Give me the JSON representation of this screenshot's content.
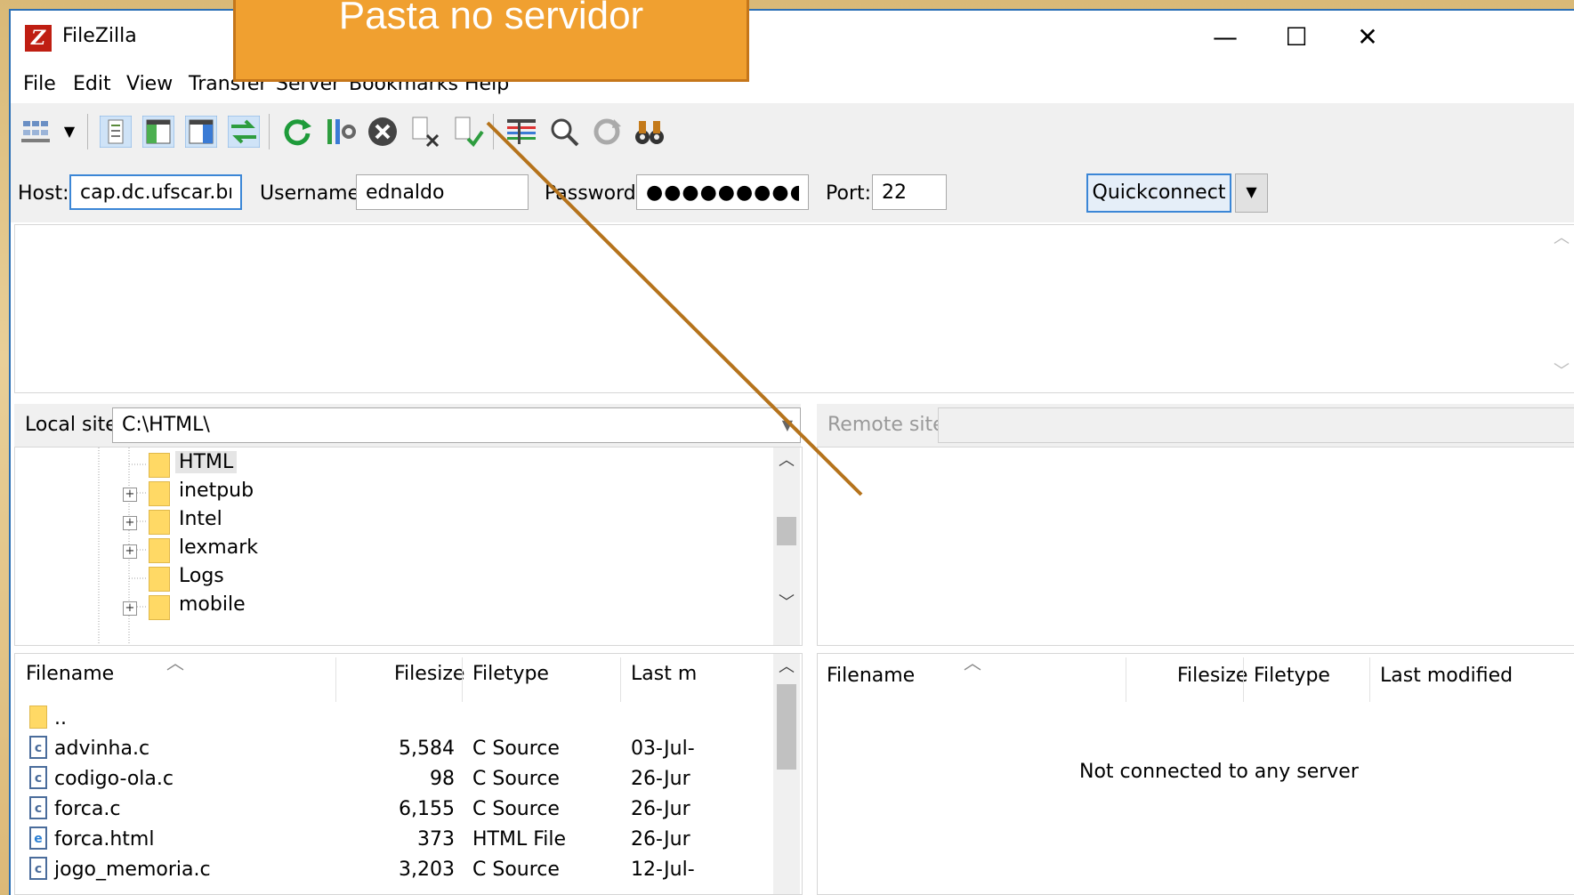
{
  "window": {
    "title": "FileZilla",
    "minimize": "—",
    "maximize": "☐",
    "close": "✕"
  },
  "menu": [
    "File",
    "Edit",
    "View",
    "Transfer",
    "Server",
    "Bookmarks",
    "Help"
  ],
  "toolbar": {
    "icons": [
      "site-manager-icon",
      "dropdown-icon",
      "toggle-log-icon",
      "toggle-local-tree-icon",
      "toggle-remote-tree-icon",
      "toggle-queue-icon",
      "refresh-icon",
      "process-queue-icon",
      "cancel-icon",
      "disconnect-icon",
      "reconnect-icon",
      "filter-icon",
      "compare-icon",
      "sync-browse-icon",
      "search-binoculars-icon"
    ]
  },
  "quickconnect": {
    "host_label": "Host:",
    "host_value": "cap.dc.ufscar.br",
    "username_label": "Username:",
    "username_value": "ednaldo",
    "password_label": "Password:",
    "password_value": "●●●●●●●●●●●",
    "port_label": "Port:",
    "port_value": "22",
    "button": "Quickconnect",
    "dropdown": "▼"
  },
  "local_site": {
    "label": "Local site:",
    "path": "C:\\HTML\\",
    "tree": [
      {
        "name": "HTML",
        "expandable": false,
        "selected": true
      },
      {
        "name": "inetpub",
        "expandable": true
      },
      {
        "name": "Intel",
        "expandable": true
      },
      {
        "name": "lexmark",
        "expandable": true
      },
      {
        "name": "Logs",
        "expandable": false
      },
      {
        "name": "mobile",
        "expandable": true
      }
    ]
  },
  "remote_site": {
    "label": "Remote site:",
    "path": ""
  },
  "local_files": {
    "columns": [
      "Filename",
      "Filesize",
      "Filetype",
      "Last m"
    ],
    "rows": [
      {
        "icon": "dir",
        "name": "..",
        "size": "",
        "type": "",
        "modified": ""
      },
      {
        "icon": "c",
        "name": "advinha.c",
        "size": "5,584",
        "type": "C Source",
        "modified": "03-Jul-"
      },
      {
        "icon": "c",
        "name": "codigo-ola.c",
        "size": "98",
        "type": "C Source",
        "modified": "26-Jur"
      },
      {
        "icon": "c",
        "name": "forca.c",
        "size": "6,155",
        "type": "C Source",
        "modified": "26-Jur"
      },
      {
        "icon": "html",
        "name": "forca.html",
        "size": "373",
        "type": "HTML File",
        "modified": "26-Jur"
      },
      {
        "icon": "c",
        "name": "jogo_memoria.c",
        "size": "3,203",
        "type": "C Source",
        "modified": "12-Jul-"
      }
    ]
  },
  "remote_files": {
    "columns": [
      "Filename",
      "Filesize",
      "Filetype",
      "Last modified"
    ],
    "message": "Not connected to any server"
  },
  "annotation": {
    "callout": "Pasta no servidor"
  },
  "colors": {
    "callout_fill": "#f0a030",
    "pointer_line": "#b5731c",
    "focus_blue": "#3b86d6"
  }
}
